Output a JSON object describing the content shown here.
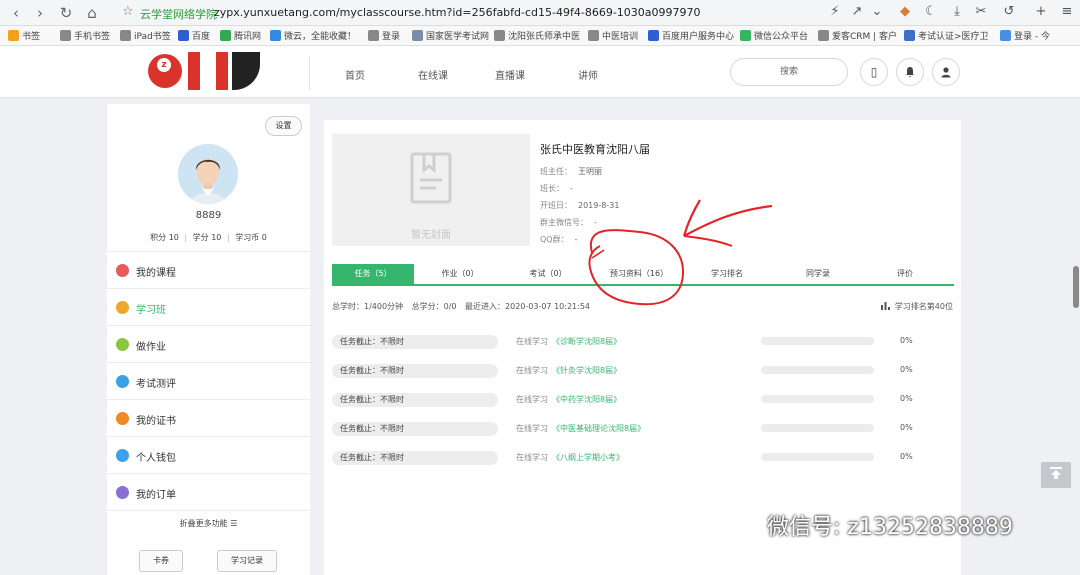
{
  "browser": {
    "site_name": "云学堂网络学院",
    "url": "zypx.yunxuetang.com/myclasscourse.htm?id=256fabfd-cd15-49f4-8669-1030a0997970",
    "bookmarks": [
      {
        "label": "书签",
        "icon": "star-icon",
        "color": "#f1a21d"
      },
      {
        "label": "手机书签",
        "icon": "phone-icon",
        "color": "#888888"
      },
      {
        "label": "iPad书签",
        "icon": "tablet-icon",
        "color": "#888888"
      },
      {
        "label": "百度",
        "icon": "baidu-icon",
        "color": "#2d5fd3"
      },
      {
        "label": "腾讯网",
        "icon": "tencent-icon",
        "color": "#33a852"
      },
      {
        "label": "微云，全能收藏！",
        "icon": "weiyun-icon",
        "color": "#2f8ce2"
      },
      {
        "label": "登录",
        "icon": "globe-icon",
        "color": "#888888"
      },
      {
        "label": "国家医学考试网",
        "icon": "page-icon",
        "color": "#7a8ca8"
      },
      {
        "label": "沈阳张氏师承中医",
        "icon": "globe-icon",
        "color": "#888888"
      },
      {
        "label": "中医培训",
        "icon": "globe-icon",
        "color": "#888888"
      },
      {
        "label": "百度用户服务中心",
        "icon": "paw-icon",
        "color": "#2d5fd3"
      },
      {
        "label": "微信公众平台",
        "icon": "wechat-icon",
        "color": "#35b65c"
      },
      {
        "label": "爱客CRM | 客户",
        "icon": "globe-icon",
        "color": "#888888"
      },
      {
        "label": "考试认证>医疗卫",
        "icon": "cert-icon",
        "color": "#3c6fc6"
      },
      {
        "label": "登录 - 今",
        "icon": "user-icon",
        "color": "#4a90e2"
      }
    ]
  },
  "header": {
    "nav": [
      "首页",
      "在线课",
      "直播课",
      "讲师"
    ],
    "search_label": "搜索"
  },
  "sidebar": {
    "settings_label": "设置",
    "username": "8889",
    "stats": [
      {
        "label": "积分",
        "value": "10"
      },
      {
        "label": "学分",
        "value": "10"
      },
      {
        "label": "学习币",
        "value": "0"
      }
    ],
    "menu": [
      {
        "label": "我的课程",
        "color": "#e65a5a",
        "active": false
      },
      {
        "label": "学习班",
        "color": "#f0a62b",
        "active": true
      },
      {
        "label": "做作业",
        "color": "#8cc63f",
        "active": false
      },
      {
        "label": "考试测评",
        "color": "#3aa0e8",
        "active": false
      },
      {
        "label": "我的证书",
        "color": "#f08a24",
        "active": false
      },
      {
        "label": "个人钱包",
        "color": "#3aa0e8",
        "active": false
      },
      {
        "label": "我的订单",
        "color": "#8a6fd8",
        "active": false
      }
    ],
    "more_label": "折叠更多功能",
    "buttons": [
      "卡券",
      "学习记录"
    ]
  },
  "classinfo": {
    "cover_placeholder": "暂无封面",
    "title": "张氏中医教育沈阳八届",
    "fields": [
      {
        "label": "班主任：",
        "value": "王明丽"
      },
      {
        "label": "班长：",
        "value": "-"
      },
      {
        "label": "开班日：",
        "value": "2019-8-31"
      },
      {
        "label": "群主微信号：",
        "value": "-"
      },
      {
        "label": "QQ群：",
        "value": "-"
      }
    ]
  },
  "tabs": [
    {
      "label": "任务（5）",
      "active": true
    },
    {
      "label": "作业（0）",
      "active": false
    },
    {
      "label": "考试（0）",
      "active": false
    },
    {
      "label": "预习资料（16）",
      "active": false
    },
    {
      "label": "学习排名",
      "active": false
    },
    {
      "label": "同学录",
      "active": false
    },
    {
      "label": "评价",
      "active": false
    }
  ],
  "summary": {
    "total_time": "总学时：1/400分钟",
    "total_credit": "总学分：0/0",
    "last_visit": "最近进入：2020-03-07 10:21:54",
    "rank": "学习排名第40位"
  },
  "tasks": [
    {
      "deadline": "任务截止：不限时",
      "type": "在线学习",
      "title": "《诊断学沈阳8届》",
      "progress": 0,
      "percent": "0%"
    },
    {
      "deadline": "任务截止：不限时",
      "type": "在线学习",
      "title": "《针灸学沈阳8届》",
      "progress": 0,
      "percent": "0%"
    },
    {
      "deadline": "任务截止：不限时",
      "type": "在线学习",
      "title": "《中药学沈阳8届》",
      "progress": 0,
      "percent": "0%"
    },
    {
      "deadline": "任务截止：不限时",
      "type": "在线学习",
      "title": "《中医基础理论沈阳8届》",
      "progress": 0,
      "percent": "0%"
    },
    {
      "deadline": "任务截止：不限时",
      "type": "在线学习",
      "title": "《八纲上学期小考》",
      "progress": 0,
      "percent": "0%"
    }
  ],
  "watermark": "微信号: z13252838889",
  "colors": {
    "accent": "#34b66f",
    "annotation": "#e0262a"
  }
}
